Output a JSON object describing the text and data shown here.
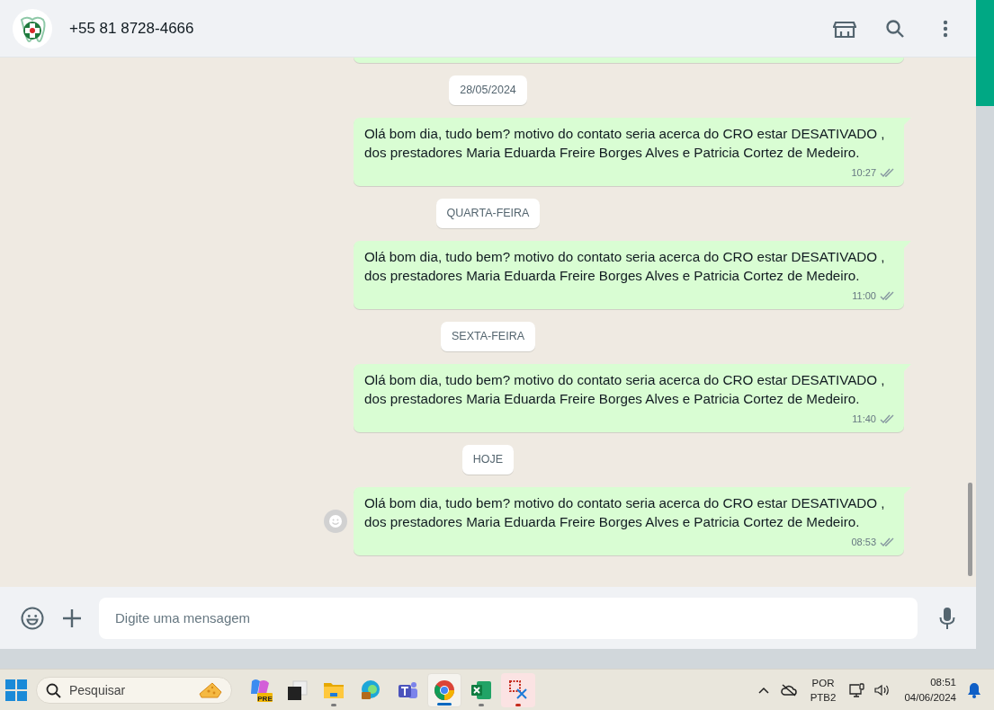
{
  "header": {
    "contact_name": "+55 81 8728-4666"
  },
  "chat": {
    "items": [
      {
        "kind": "cut_message"
      },
      {
        "kind": "date",
        "label": "28/05/2024"
      },
      {
        "kind": "message",
        "text": "Olá bom dia, tudo bem? motivo do contato seria acerca do CRO estar DESATIVADO , dos prestadores Maria Eduarda Freire Borges Alves e Patricia Cortez de Medeiro.",
        "time": "10:27",
        "read": false,
        "reaction_button": false
      },
      {
        "kind": "date",
        "label": "QUARTA-FEIRA"
      },
      {
        "kind": "message",
        "text": "Olá bom dia, tudo bem? motivo do contato seria acerca do CRO estar DESATIVADO , dos prestadores Maria Eduarda Freire Borges Alves e Patricia Cortez de Medeiro.",
        "time": "11:00",
        "read": false,
        "reaction_button": false
      },
      {
        "kind": "date",
        "label": "SEXTA-FEIRA"
      },
      {
        "kind": "message",
        "text": "Olá bom dia, tudo bem? motivo do contato seria acerca do CRO estar DESATIVADO , dos prestadores Maria Eduarda Freire Borges Alves e Patricia Cortez de Medeiro.",
        "time": "11:40",
        "read": false,
        "reaction_button": false
      },
      {
        "kind": "date",
        "label": "HOJE"
      },
      {
        "kind": "message",
        "text": "Olá bom dia, tudo bem? motivo do contato seria acerca do CRO estar DESATIVADO , dos prestadores Maria Eduarda Freire Borges Alves e Patricia Cortez de Medeiro.",
        "time": "08:53",
        "read": false,
        "reaction_button": true
      }
    ]
  },
  "composer": {
    "placeholder": "Digite uma mensagem"
  },
  "taskbar": {
    "search_placeholder": "Pesquisar",
    "apps": [
      {
        "kind": "copilot",
        "badge": "PRE",
        "selected": false,
        "running": false
      },
      {
        "kind": "windows",
        "selected": false,
        "running": false
      },
      {
        "kind": "folder",
        "selected": false,
        "running": true
      },
      {
        "kind": "edge",
        "selected": false,
        "running": false
      },
      {
        "kind": "teams",
        "selected": false,
        "running": false
      },
      {
        "kind": "chrome",
        "selected": true,
        "running": true
      },
      {
        "kind": "excel",
        "selected": false,
        "running": true
      },
      {
        "kind": "snip",
        "selected": false,
        "running": true
      }
    ],
    "language": "POR",
    "layout": "PTB2",
    "time": "08:51",
    "date": "04/06/2024"
  }
}
